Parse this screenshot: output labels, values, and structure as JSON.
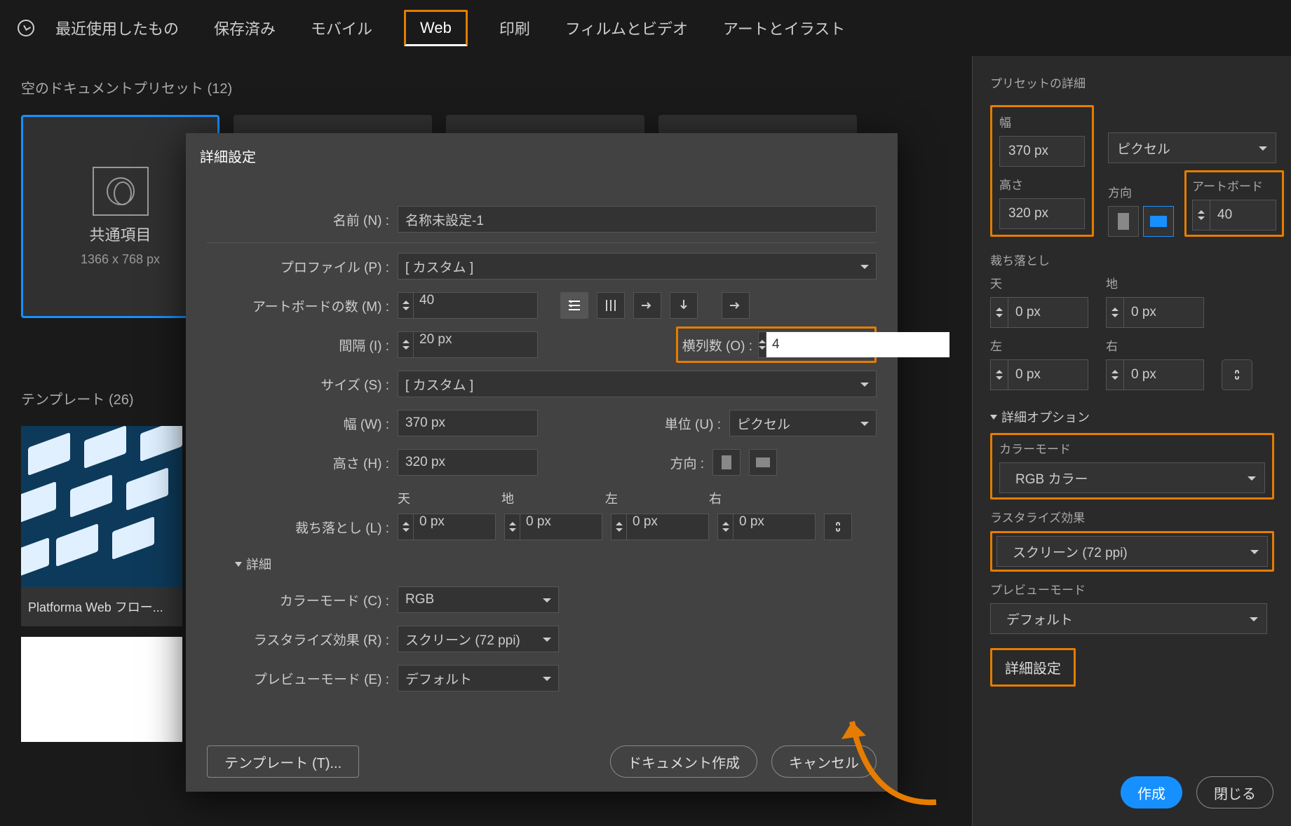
{
  "tabs": {
    "recent": "最近使用したもの",
    "saved": "保存済み",
    "mobile": "モバイル",
    "web": "Web",
    "print": "印刷",
    "film": "フィルムとビデオ",
    "art": "アートとイラスト"
  },
  "presets": {
    "header": "空のドキュメントプリセット  (12)",
    "card1_name": "共通項目",
    "card1_dim": "1366 x 768 px"
  },
  "templates": {
    "header": "テンプレート  (26)",
    "t1_name": "Platforma Web フロー..."
  },
  "dialog": {
    "title": "詳細設定",
    "name_label": "名前 (N) :",
    "name_value": "名称未設定-1",
    "profile_label": "プロファイル (P) :",
    "profile_value": "[ カスタム ]",
    "artboards_label": "アートボードの数 (M) :",
    "artboards_value": "40",
    "spacing_label": "間隔 (I) :",
    "spacing_value": "20 px",
    "columns_label": "横列数 (O) :",
    "columns_value": "4",
    "size_label": "サイズ (S) :",
    "size_value": "[ カスタム ]",
    "width_label": "幅 (W) :",
    "width_value": "370 px",
    "unit_label": "単位 (U) :",
    "unit_value": "ピクセル",
    "height_label": "高さ (H) :",
    "height_value": "320 px",
    "orient_label": "方向 :",
    "bleed_label": "裁ち落とし (L) :",
    "bleed_top_h": "天",
    "bleed_bottom_h": "地",
    "bleed_left_h": "左",
    "bleed_right_h": "右",
    "bleed_top": "0 px",
    "bleed_bottom": "0 px",
    "bleed_left": "0 px",
    "bleed_right": "0 px",
    "details": "詳細",
    "colormode_label": "カラーモード (C) :",
    "colormode_value": "RGB",
    "raster_label": "ラスタライズ効果 (R) :",
    "raster_value": "スクリーン (72 ppi)",
    "preview_label": "プレビューモード (E) :",
    "preview_value": "デフォルト",
    "template_btn": "テンプレート (T)...",
    "create_btn": "ドキュメント作成",
    "cancel_btn": "キャンセル"
  },
  "panel": {
    "title": "プリセットの詳細",
    "width_label": "幅",
    "width_value": "370 px",
    "unit_value": "ピクセル",
    "height_label": "高さ",
    "height_value": "320 px",
    "orient_label": "方向",
    "artboard_label": "アートボード",
    "artboard_value": "40",
    "bleed_label": "裁ち落とし",
    "bleed_top_l": "天",
    "bleed_bottom_l": "地",
    "bleed_left_l": "左",
    "bleed_right_l": "右",
    "bleed_top": "0 px",
    "bleed_bottom": "0 px",
    "bleed_left": "0 px",
    "bleed_right": "0 px",
    "advanced": "詳細オプション",
    "colormode_label": "カラーモード",
    "colormode_value": "RGB カラー",
    "raster_label": "ラスタライズ効果",
    "raster_value": "スクリーン (72 ppi)",
    "preview_label": "プレビューモード",
    "preview_value": "デフォルト",
    "more_btn": "詳細設定",
    "create_btn": "作成",
    "close_btn": "閉じる"
  }
}
